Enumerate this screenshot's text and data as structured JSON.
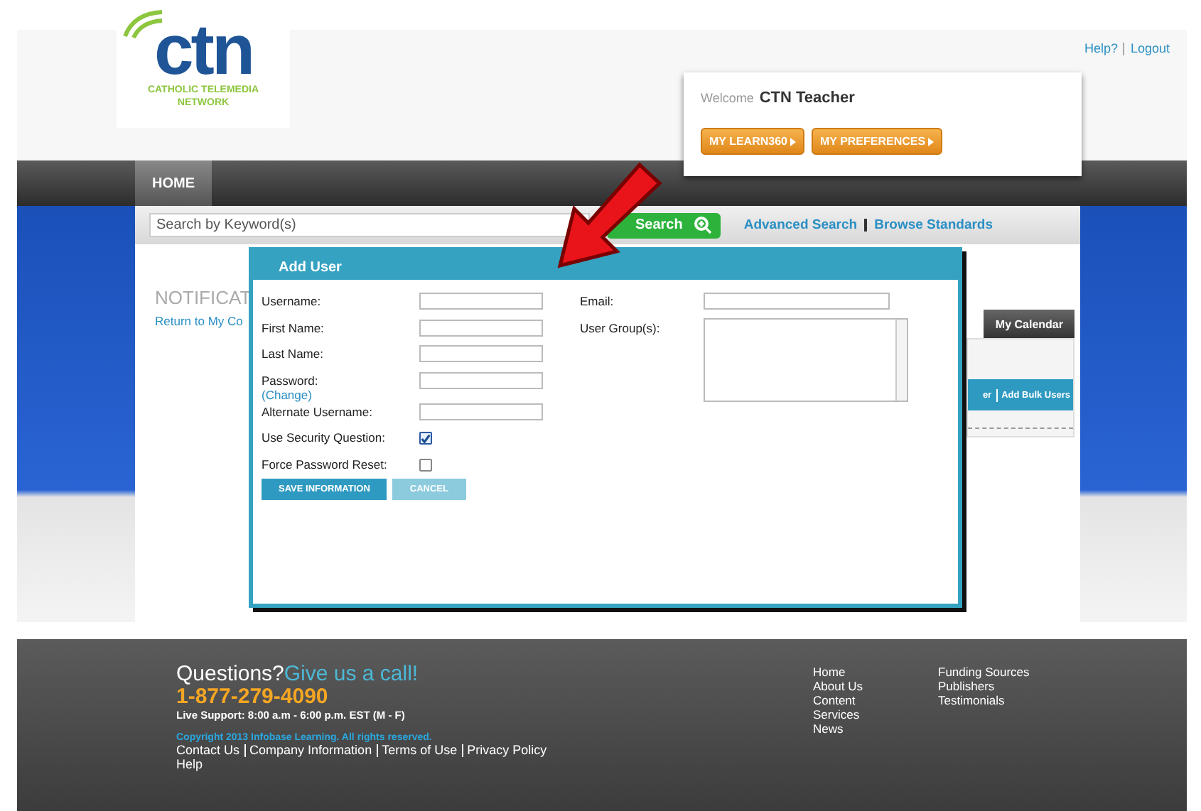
{
  "logo": {
    "mark": "ctn",
    "subtitle": "CATHOLIC TELEMEDIA NETWORK"
  },
  "top_links": [
    "Help?",
    "Logout"
  ],
  "welcome": {
    "greeting": "Welcome",
    "user": "CTN Teacher",
    "buttons": [
      "MY LEARN360",
      "MY PREFERENCES"
    ]
  },
  "nav_tabs": [
    {
      "label": "HOME",
      "selected": true
    }
  ],
  "search": {
    "placeholder": "Search by Keyword(s)",
    "button": "Search",
    "links": [
      "Advanced Search",
      "Browse Standards"
    ]
  },
  "background": {
    "heading": "NOTIFICAT",
    "link": "Return to My Co",
    "tab": "My Calendar",
    "bar_links": [
      "er",
      "Add Bulk Users"
    ]
  },
  "dialog": {
    "title": "Add User",
    "left_fields": [
      {
        "kind": "text",
        "label": "Username:"
      },
      {
        "kind": "text",
        "label": "First Name:"
      },
      {
        "kind": "text",
        "label": "Last Name:"
      },
      {
        "kind": "password",
        "label": "Password:",
        "link": "(Change)"
      },
      {
        "kind": "text",
        "label": "Alternate Username:"
      },
      {
        "kind": "checkbox",
        "label": "Use Security Question:",
        "checked": true
      },
      {
        "kind": "checkbox",
        "label": "Force Password Reset:",
        "checked": false
      }
    ],
    "right_fields": [
      {
        "kind": "text",
        "label": "Email:"
      },
      {
        "kind": "list",
        "label": "User Group(s):"
      }
    ],
    "buttons": [
      {
        "label": "SAVE INFORMATION",
        "disabled": false
      },
      {
        "label": "CANCEL",
        "disabled": true
      }
    ]
  },
  "footer": {
    "question": "Questions?",
    "call": "Give us a call!",
    "phone": "1-877-279-4090",
    "support": "Live Support: 8:00 a.m - 6:00 p.m. EST (M - F)",
    "copyright": "Copyright 2013 Infobase Learning. All rights reserved.",
    "links": [
      "Contact Us",
      "Company Information",
      "Terms of Use",
      "Privacy Policy"
    ],
    "help": "Help",
    "nav_col_1": [
      "Home",
      "About Us",
      "Content",
      "Services",
      "News"
    ],
    "nav_col_2": [
      "Funding Sources",
      "Publishers",
      "Testimonials"
    ]
  }
}
